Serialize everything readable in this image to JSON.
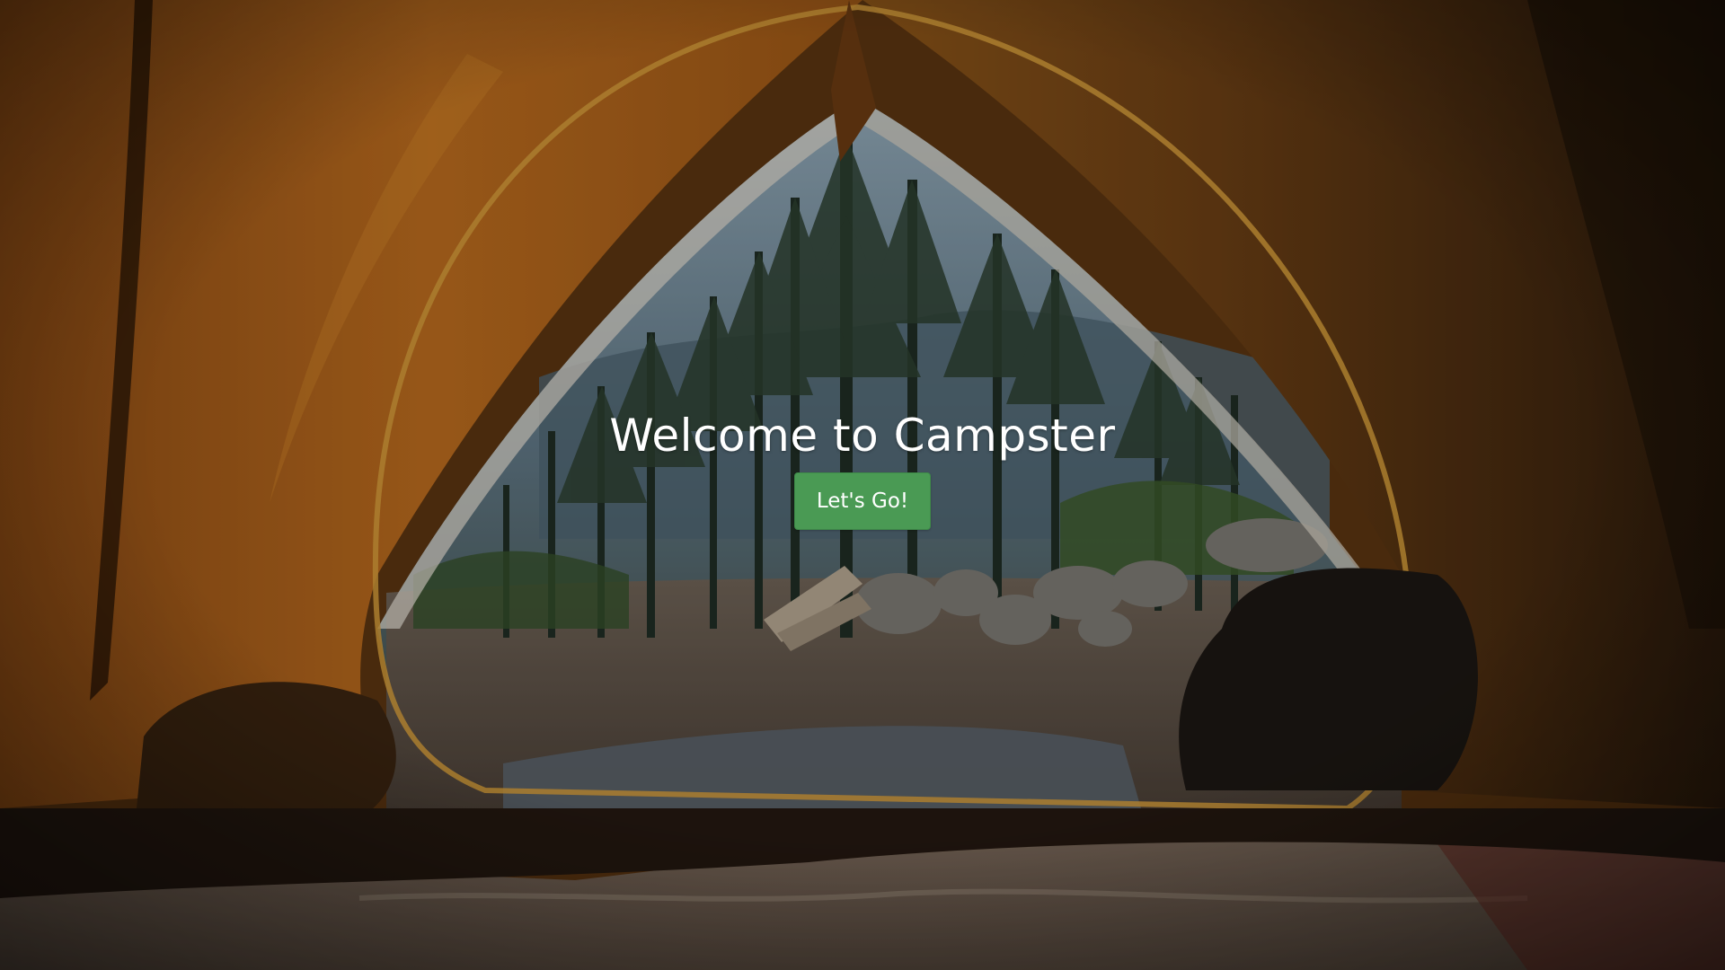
{
  "hero": {
    "title": "Welcome to Campster",
    "button_label": "Let's Go!",
    "background_image": "tent-forest-view",
    "accent_color": "#4a9a54"
  }
}
